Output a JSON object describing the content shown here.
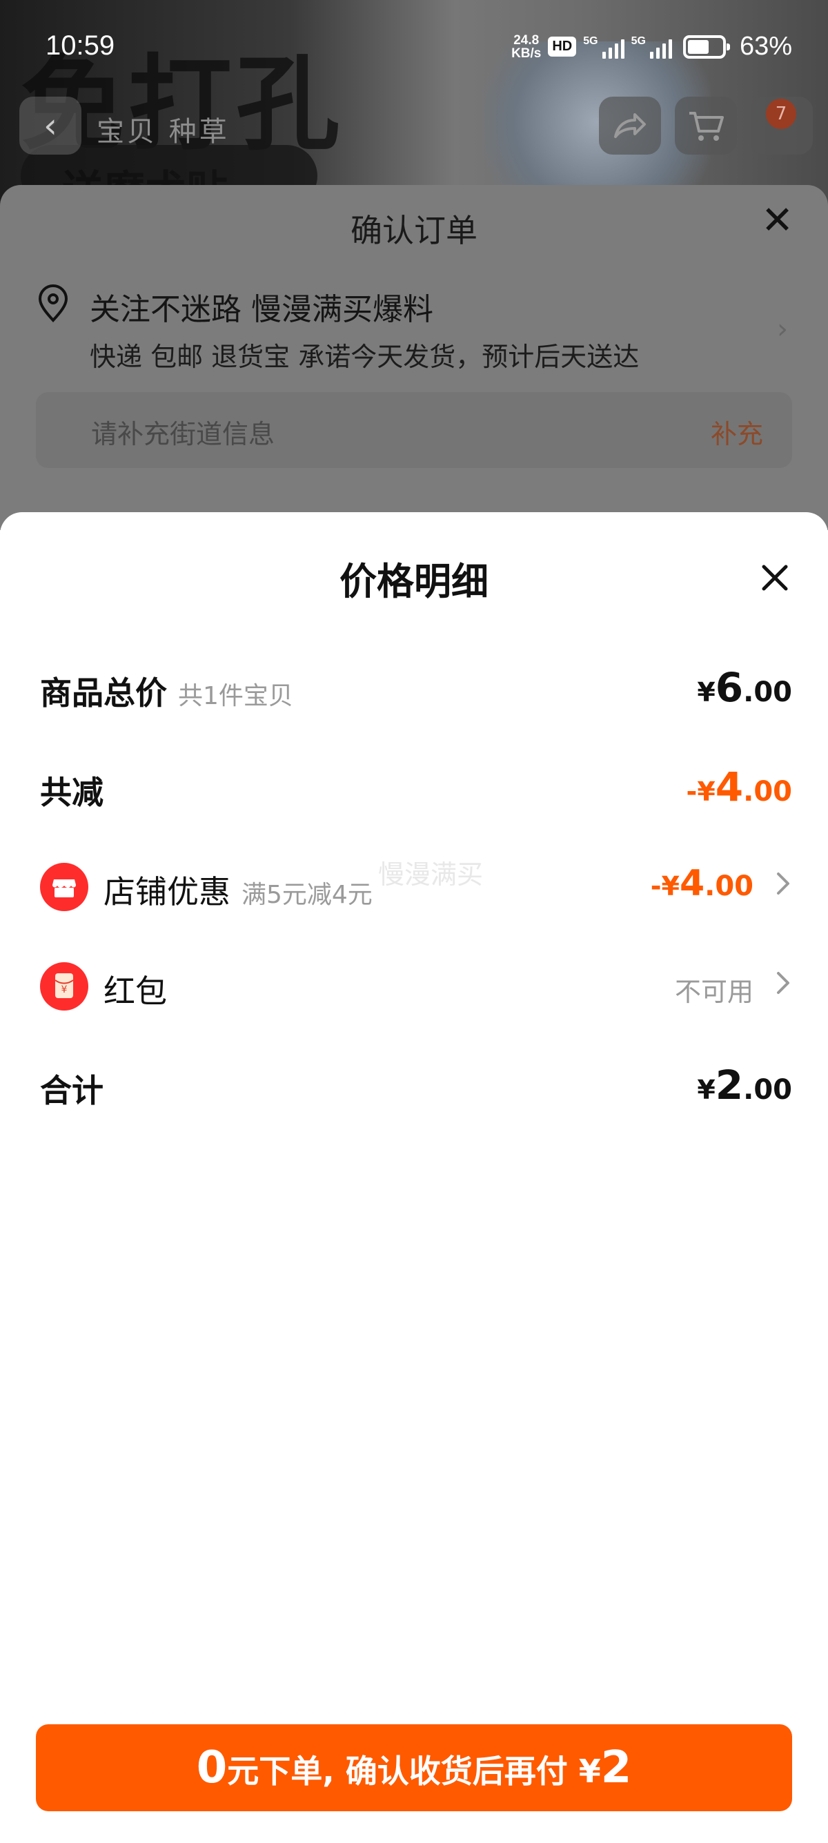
{
  "status_bar": {
    "time": "10:59",
    "net_speed_value": "24.8",
    "net_speed_unit": "KB/s",
    "hd_label": "HD",
    "sim1_label": "5G",
    "sim2_label": "5G",
    "battery_percent": "63%",
    "battery_level": 0.63
  },
  "background_page": {
    "banner_text": "免打孔",
    "banner_subtext": "送磨术贴",
    "nav_tabs": "宝贝 种草",
    "cart_badge": "7"
  },
  "order_sheet": {
    "title": "确认订单",
    "address_name": "关注不迷路 慢漫满买爆料",
    "address_detail": "快递 包邮 退货宝 承诺今天发货，预计后天送达",
    "street_placeholder": "请补充街道信息",
    "street_action": "补充"
  },
  "price_sheet": {
    "title": "价格明细",
    "rows": [
      {
        "label": "商品总价",
        "sub": "共1件宝贝",
        "currency": "¥",
        "int": "6",
        "dot": ".",
        "dec": "00"
      },
      {
        "label": "共减",
        "prefix": "-",
        "currency": "¥",
        "int": "4",
        "dot": ".",
        "dec": "00"
      },
      {
        "label": "店铺优惠",
        "sub": "满5元减4元",
        "prefix": "-",
        "currency": "¥",
        "int": "4",
        "dot": ".",
        "dec": "00",
        "watermark": "慢漫满买"
      },
      {
        "label": "红包",
        "status": "不可用"
      },
      {
        "label": "合计",
        "currency": "¥",
        "int": "2",
        "dot": ".",
        "dec": "00"
      }
    ]
  },
  "cta": {
    "zero": "0",
    "text_a": "元下单, 确认收货后再付 ",
    "currency": "¥",
    "amount": "2"
  },
  "colors": {
    "accent": "#ff5a00",
    "icon_red": "#ff2c2c"
  }
}
